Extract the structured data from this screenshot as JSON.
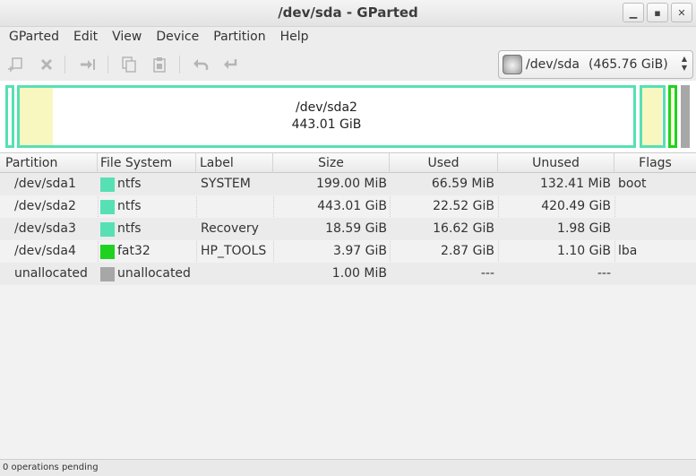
{
  "window": {
    "title": "/dev/sda - GParted"
  },
  "menu": [
    "GParted",
    "Edit",
    "View",
    "Device",
    "Partition",
    "Help"
  ],
  "toolbar": {
    "device": "/dev/sda",
    "device_size": "(465.76 GiB)"
  },
  "disk_map": {
    "selected_name": "/dev/sda2",
    "selected_size": "443.01 GiB"
  },
  "colors": {
    "ntfs": "#57e0b3",
    "fat32": "#1fd21f",
    "unallocated": "#a7a7a7",
    "used": "#f8f7c0"
  },
  "table": {
    "headers": [
      "Partition",
      "File System",
      "Label",
      "Size",
      "Used",
      "Unused",
      "Flags"
    ],
    "rows": [
      {
        "partition": "/dev/sda1",
        "filesystem": "ntfs",
        "label": "SYSTEM",
        "size": "199.00 MiB",
        "used": "66.59 MiB",
        "unused": "132.41 MiB",
        "flags": "boot"
      },
      {
        "partition": "/dev/sda2",
        "filesystem": "ntfs",
        "label": "",
        "size": "443.01 GiB",
        "used": "22.52 GiB",
        "unused": "420.49 GiB",
        "flags": ""
      },
      {
        "partition": "/dev/sda3",
        "filesystem": "ntfs",
        "label": "Recovery",
        "size": "18.59 GiB",
        "used": "16.62 GiB",
        "unused": "1.98 GiB",
        "flags": ""
      },
      {
        "partition": "/dev/sda4",
        "filesystem": "fat32",
        "label": "HP_TOOLS",
        "size": "3.97 GiB",
        "used": "2.87 GiB",
        "unused": "1.10 GiB",
        "flags": "lba"
      },
      {
        "partition": "unallocated",
        "filesystem": "unallocated",
        "label": "",
        "size": "1.00 MiB",
        "used": "---",
        "unused": "---",
        "flags": ""
      }
    ]
  },
  "status": {
    "text": "0 operations pending"
  }
}
